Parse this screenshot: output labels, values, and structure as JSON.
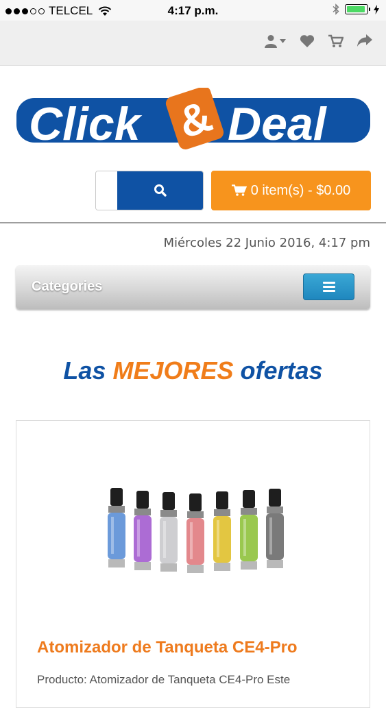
{
  "status_bar": {
    "carrier": "TELCEL",
    "time": "4:17 p.m."
  },
  "top_nav": {
    "icons": [
      "user-icon",
      "heart-icon",
      "cart-icon",
      "share-icon"
    ]
  },
  "logo": {
    "text_left": "Click",
    "ampersand": "&",
    "text_right": "Deal"
  },
  "search": {
    "placeholder": ""
  },
  "cart": {
    "label": "0 item(s) - $0.00"
  },
  "date": "Miércoles 22 Junio 2016, 4:17 pm",
  "categories": {
    "label": "Categories"
  },
  "headline": {
    "part1": "Las",
    "part2": "MEJORES",
    "part3": "ofertas"
  },
  "product": {
    "title": "Atomizador de Tanqueta CE4-Pro",
    "description": "Producto: Atomizador de Tanqueta CE4-Pro Este"
  },
  "colors": {
    "brand_blue": "#0f52a4",
    "brand_orange": "#f7941d",
    "menu_blue": "#2a97cb"
  }
}
